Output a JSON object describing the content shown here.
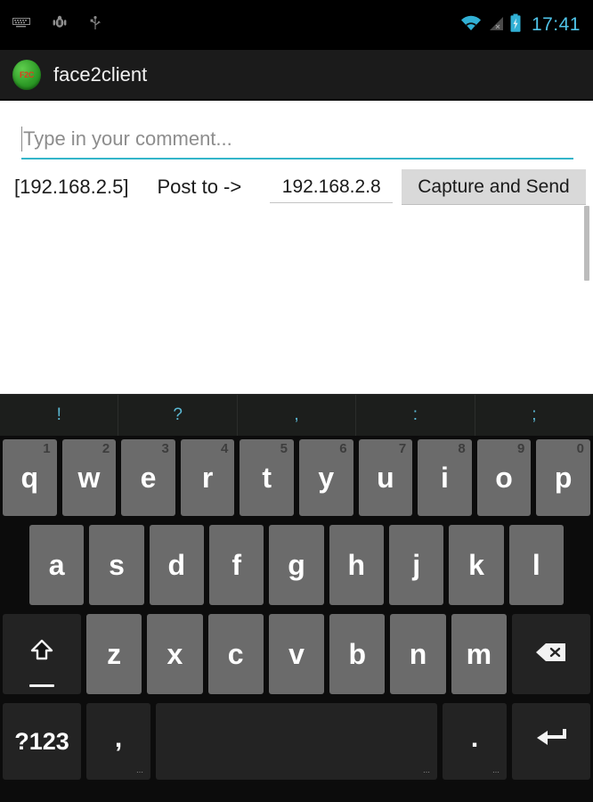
{
  "status_bar": {
    "left_icons": [
      {
        "name": "keyboard-icon",
        "label": "keyboard"
      },
      {
        "name": "android-debug-icon",
        "label": "android-debug"
      },
      {
        "name": "usb-icon",
        "label": "usb"
      }
    ],
    "right_icons": [
      {
        "name": "wifi-icon",
        "label": "wifi"
      },
      {
        "name": "cell-signal-icon",
        "label": "cell-signal-none"
      },
      {
        "name": "battery-charging-icon",
        "label": "battery-charging"
      }
    ],
    "clock": "17:41",
    "clock_color": "#4fc3e8",
    "background": "#000000"
  },
  "action_bar": {
    "app_icon_text": "F2C",
    "title": "face2client",
    "background": "#1b1b1b"
  },
  "content": {
    "comment_input": {
      "value": "",
      "placeholder": "Type in your comment...",
      "focused": true,
      "underline_color": "#33b5c9"
    },
    "local_ip_label": "[192.168.2.5]",
    "post_to_label": "Post to ->",
    "target_ip_input": {
      "value": "192.168.2.8",
      "underline_color": "#c4c4c4"
    },
    "capture_button_label": "Capture and Send",
    "capture_button_color": "#d9d9d9",
    "background": "#ffffff",
    "scrollbar_visible": true
  },
  "keyboard": {
    "background": "#0c0c0c",
    "key_color": "#6b6b6b",
    "dark_key_color": "#232323",
    "suggestion_color": "#5bb9d4",
    "suggestions": [
      "!",
      "?",
      ",",
      ":",
      ";"
    ],
    "row1": [
      {
        "label": "q",
        "hint": "1"
      },
      {
        "label": "w",
        "hint": "2"
      },
      {
        "label": "e",
        "hint": "3"
      },
      {
        "label": "r",
        "hint": "4"
      },
      {
        "label": "t",
        "hint": "5"
      },
      {
        "label": "y",
        "hint": "6"
      },
      {
        "label": "u",
        "hint": "7"
      },
      {
        "label": "i",
        "hint": "8"
      },
      {
        "label": "o",
        "hint": "9"
      },
      {
        "label": "p",
        "hint": "0"
      }
    ],
    "row2": [
      {
        "label": "a"
      },
      {
        "label": "s"
      },
      {
        "label": "d"
      },
      {
        "label": "f"
      },
      {
        "label": "g"
      },
      {
        "label": "h"
      },
      {
        "label": "j"
      },
      {
        "label": "k"
      },
      {
        "label": "l"
      }
    ],
    "row3": {
      "shift": "shift-key",
      "letters": [
        {
          "label": "z"
        },
        {
          "label": "x"
        },
        {
          "label": "c"
        },
        {
          "label": "v"
        },
        {
          "label": "b"
        },
        {
          "label": "n"
        },
        {
          "label": "m"
        }
      ],
      "backspace": "backspace-key"
    },
    "row4": {
      "symbols_label": "?123",
      "comma_label": ",",
      "space_label": "",
      "period_label": ".",
      "enter_label": "enter-key"
    }
  }
}
